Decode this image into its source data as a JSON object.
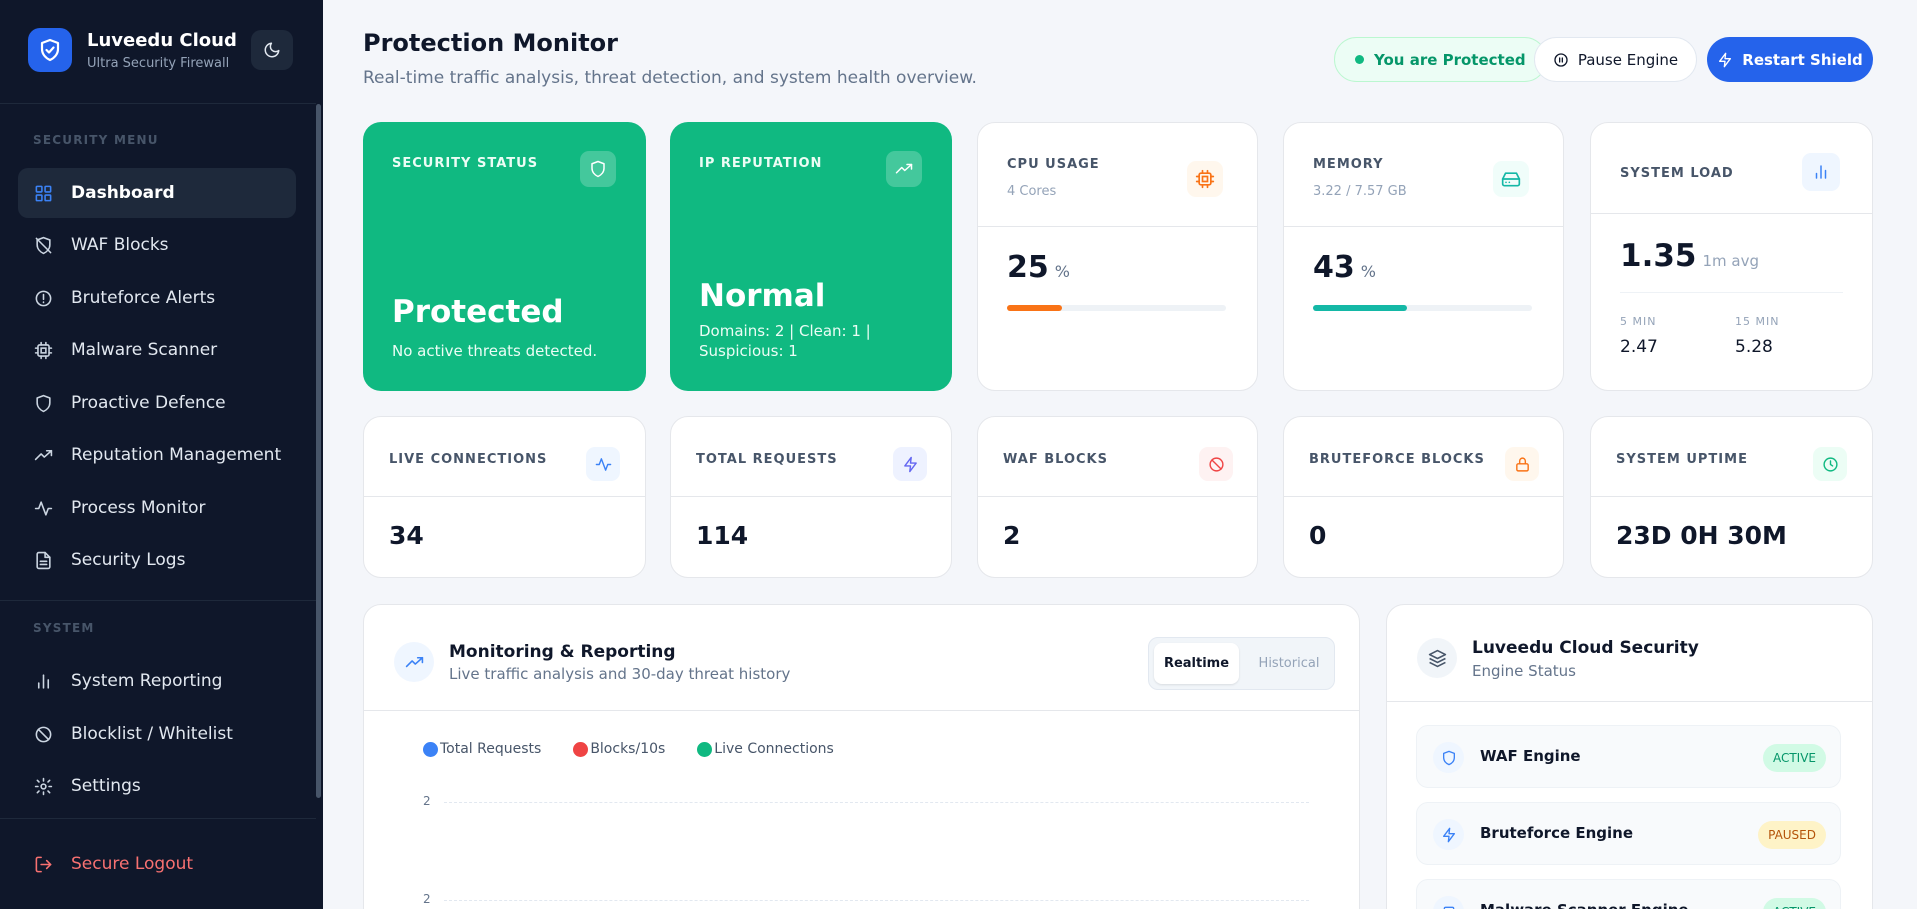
{
  "brand": {
    "name": "Luveedu Cloud",
    "tagline": "Ultra Security Firewall"
  },
  "sidebar": {
    "security_section": "SECURITY MENU",
    "security_items": [
      {
        "label": "Dashboard",
        "icon": "grid-icon",
        "active": true
      },
      {
        "label": "WAF Blocks",
        "icon": "shield-off-icon"
      },
      {
        "label": "Bruteforce Alerts",
        "icon": "alert-circle-icon"
      },
      {
        "label": "Malware Scanner",
        "icon": "cpu-icon"
      },
      {
        "label": "Proactive Defence",
        "icon": "shield-icon"
      },
      {
        "label": "Reputation Management",
        "icon": "trending-up-icon"
      },
      {
        "label": "Process Monitor",
        "icon": "activity-icon"
      },
      {
        "label": "Security Logs",
        "icon": "file-text-icon"
      }
    ],
    "system_section": "SYSTEM",
    "system_items": [
      {
        "label": "System Reporting",
        "icon": "bar-chart-icon"
      },
      {
        "label": "Blocklist / Whitelist",
        "icon": "ban-icon"
      },
      {
        "label": "Settings",
        "icon": "gear-icon"
      }
    ],
    "logout_label": "Secure Logout"
  },
  "header": {
    "title": "Protection Monitor",
    "subtitle": "Real-time traffic analysis, threat detection, and system health overview.",
    "status_label": "You are Protected",
    "pause_label": "Pause Engine",
    "restart_label": "Restart Shield"
  },
  "cards": {
    "security_status": {
      "label": "SECURITY STATUS",
      "value": "Protected",
      "detail": "No active threats detected."
    },
    "ip_reputation": {
      "label": "IP REPUTATION",
      "value": "Normal",
      "detail": "Domains: 2 | Clean: 1 | Suspicious: 1"
    },
    "cpu": {
      "label": "CPU USAGE",
      "sub": "4 Cores",
      "value": "25",
      "unit": "%",
      "percent": 25
    },
    "memory": {
      "label": "MEMORY",
      "sub": "3.22 / 7.57 GB",
      "value": "43",
      "unit": "%",
      "percent": 43
    },
    "system_load": {
      "label": "SYSTEM LOAD",
      "value": "1.35",
      "avg_label": "1m avg",
      "five_label": "5 MIN",
      "five_value": "2.47",
      "fifteen_label": "15 MIN",
      "fifteen_value": "5.28"
    },
    "live_connections": {
      "label": "LIVE CONNECTIONS",
      "value": "34"
    },
    "total_requests": {
      "label": "TOTAL REQUESTS",
      "value": "114"
    },
    "waf_blocks": {
      "label": "WAF BLOCKS",
      "value": "2"
    },
    "bruteforce_blocks": {
      "label": "BRUTEFORCE BLOCKS",
      "value": "0"
    },
    "uptime": {
      "label": "SYSTEM UPTIME",
      "value": "23D 0H 30M"
    }
  },
  "monitoring": {
    "title": "Monitoring & Reporting",
    "subtitle": "Live traffic analysis and 30-day threat history",
    "tab_realtime": "Realtime",
    "tab_historical": "Historical",
    "legend": [
      {
        "label": "Total Requests",
        "color": "#3b82f6"
      },
      {
        "label": "Blocks/10s",
        "color": "#ef4444"
      },
      {
        "label": "Live Connections",
        "color": "#10b981"
      }
    ],
    "y_ticks": [
      "2",
      "2"
    ]
  },
  "engine": {
    "title": "Luveedu Cloud Security",
    "subtitle": "Engine Status",
    "items": [
      {
        "name": "WAF Engine",
        "status": "ACTIVE"
      },
      {
        "name": "Bruteforce Engine",
        "status": "PAUSED"
      },
      {
        "name": "Malware Scanner Engine",
        "status": "ACTIVE"
      }
    ]
  },
  "colors": {
    "accent": "#2563eb",
    "success": "#10b981",
    "cpu_bar": "#f97316",
    "memory_bar": "#14b8a6",
    "sidebar_bg": "#0f172a"
  }
}
